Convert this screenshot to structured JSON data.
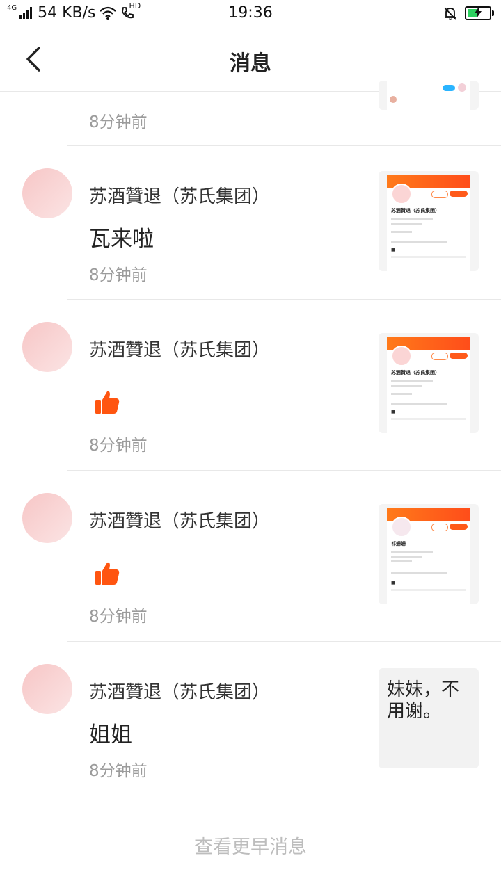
{
  "status_bar": {
    "network_type": "4G",
    "speed": "54 KB/s",
    "hd_label": "HD",
    "time": "19:36"
  },
  "header": {
    "title": "消息"
  },
  "first_item": {
    "time_ago": "8分钟前"
  },
  "messages": [
    {
      "sender": "苏酒贊退（苏氏集团）",
      "content": "瓦来啦",
      "type": "text",
      "time_ago": "8分钟前",
      "thumb_title": "苏酒贊退（苏氏集团）"
    },
    {
      "sender": "苏酒贊退（苏氏集团）",
      "content": "",
      "type": "like",
      "time_ago": "8分钟前",
      "thumb_title": "苏酒贊退（苏氏集团）"
    },
    {
      "sender": "苏酒贊退（苏氏集团）",
      "content": "",
      "type": "like",
      "time_ago": "8分钟前",
      "thumb_title": "祁姗姗"
    },
    {
      "sender": "苏酒贊退（苏氏集团）",
      "content": "姐姐",
      "type": "text",
      "time_ago": "8分钟前",
      "reply_preview": "妹妹，不用谢。"
    }
  ],
  "footer": {
    "load_more": "查看更早消息"
  },
  "colors": {
    "accent": "#ff5a1a",
    "like_icon": "#ff5510",
    "avatar": "#f7c6c6",
    "muted_text": "#9b9b9b",
    "divider": "#e8e8e8"
  },
  "icons": {
    "back": "chevron-left-icon",
    "like": "thumbs-up-icon",
    "wifi": "wifi-icon",
    "call": "phone-hd-icon",
    "mute": "bell-off-icon",
    "battery": "battery-charging-icon"
  }
}
